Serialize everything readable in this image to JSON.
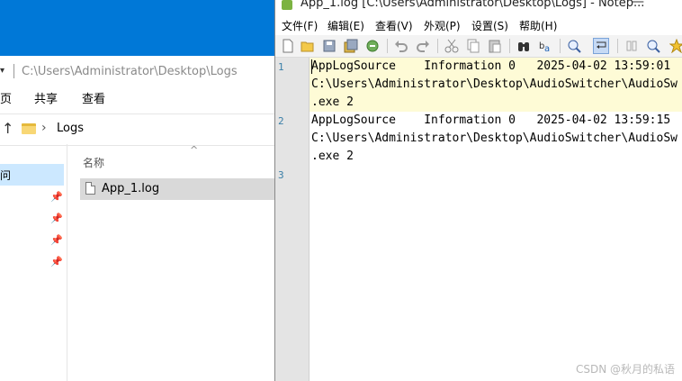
{
  "explorer": {
    "address_dropdown": "▾",
    "address_path": "C:\\Users\\Administrator\\Desktop\\Logs",
    "ribbon_tabs": [
      "页",
      "共享",
      "查看"
    ],
    "nav_up": "↑",
    "breadcrumb_chevron": "›",
    "breadcrumb_folder": "Logs",
    "nav_pane_selected": "问",
    "pin_glyph": "📌",
    "column_header_name": "名称",
    "sort_caret": "^",
    "files": [
      {
        "name": "App_1.log"
      }
    ],
    "titlebar_color": "#0078d7",
    "selection_color": "#cce8ff"
  },
  "notepad": {
    "title": "App_1.log [C:\\Users\\Administrator\\Desktop\\Logs] - Notep...",
    "minimize_glyph": "—",
    "menu": [
      "文件(F)",
      "编辑(E)",
      "查看(V)",
      "外观(P)",
      "设置(S)",
      "帮助(H)"
    ],
    "toolbar_icons": [
      "new-file-icon",
      "open-file-icon",
      "save-icon",
      "save-all-icon",
      "close-icon",
      "undo-icon",
      "redo-icon",
      "cut-icon",
      "copy-icon",
      "paste-icon",
      "find-icon",
      "replace-icon",
      "zoom-icon",
      "word-wrap-icon",
      "all-chars-icon",
      "search-icon",
      "favorite-icon"
    ],
    "line_numbers": [
      "1",
      "2",
      "3"
    ],
    "lines": [
      "AppLogSource    Information 0   2025-04-02 13:59:01",
      "C:\\Users\\Administrator\\Desktop\\AudioSwitcher\\AudioSw",
      ".exe 2",
      "AppLogSource    Information 0   2025-04-02 13:59:15",
      "C:\\Users\\Administrator\\Desktop\\AudioSwitcher\\AudioSw",
      ".exe 2"
    ],
    "current_line_color": "#fefbd6",
    "line_number_color": "#3a7fa8"
  },
  "watermark": "CSDN @秋月的私语"
}
